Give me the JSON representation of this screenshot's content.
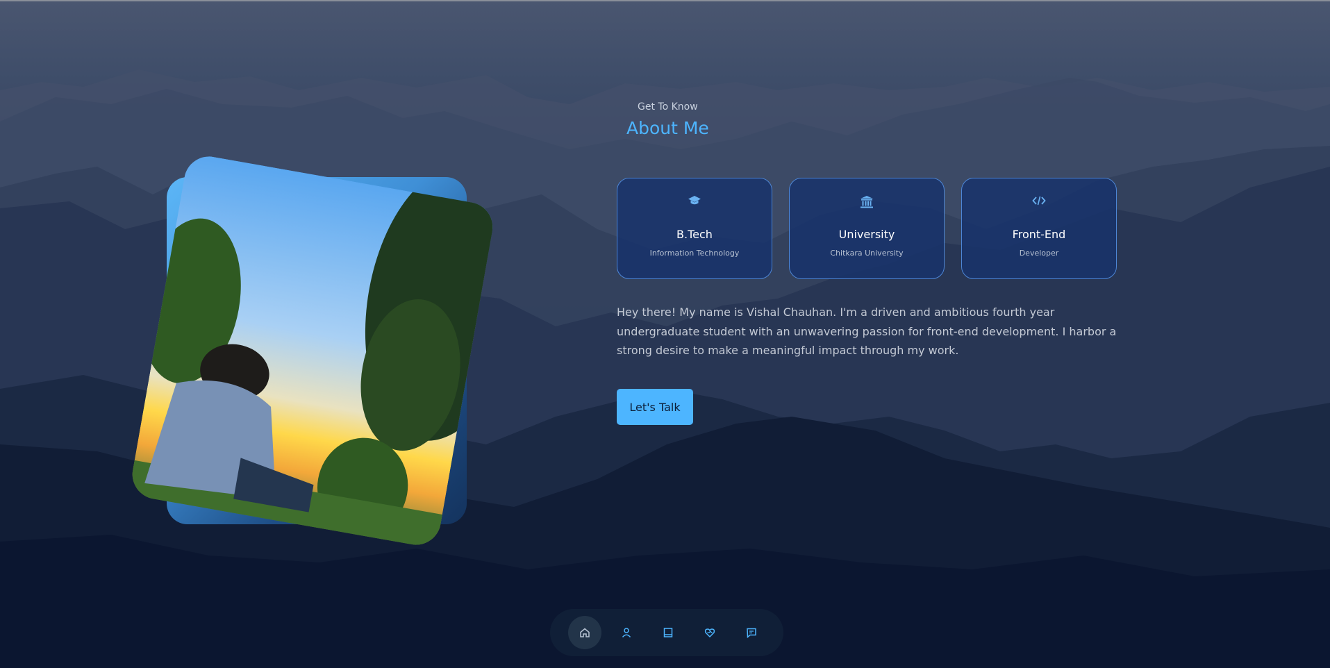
{
  "intro": {
    "subtitle": "Get To Know",
    "title": "About Me"
  },
  "cards": [
    {
      "icon": "graduation-cap-icon",
      "title": "B.Tech",
      "subtitle": "Information Technology"
    },
    {
      "icon": "institution-icon",
      "title": "University",
      "subtitle": "Chitkara University"
    },
    {
      "icon": "code-icon",
      "title": "Front-End",
      "subtitle": "Developer"
    }
  ],
  "bio": "Hey there! My name is Vishal Chauhan. I'm a driven and ambitious fourth year undergraduate student with an unwavering passion for front-end development. I harbor a strong desire to make a meaningful impact through my work.",
  "cta": {
    "label": "Let's Talk"
  },
  "nav": {
    "items": [
      {
        "icon": "home-icon",
        "active": true
      },
      {
        "icon": "user-icon",
        "active": false
      },
      {
        "icon": "book-icon",
        "active": false
      },
      {
        "icon": "services-icon",
        "active": false
      },
      {
        "icon": "message-icon",
        "active": false
      }
    ]
  },
  "colors": {
    "accent": "#4db5ff",
    "card_bg": "#18336b",
    "card_border": "#4d86d6",
    "text_muted": "#c3c9d4"
  }
}
